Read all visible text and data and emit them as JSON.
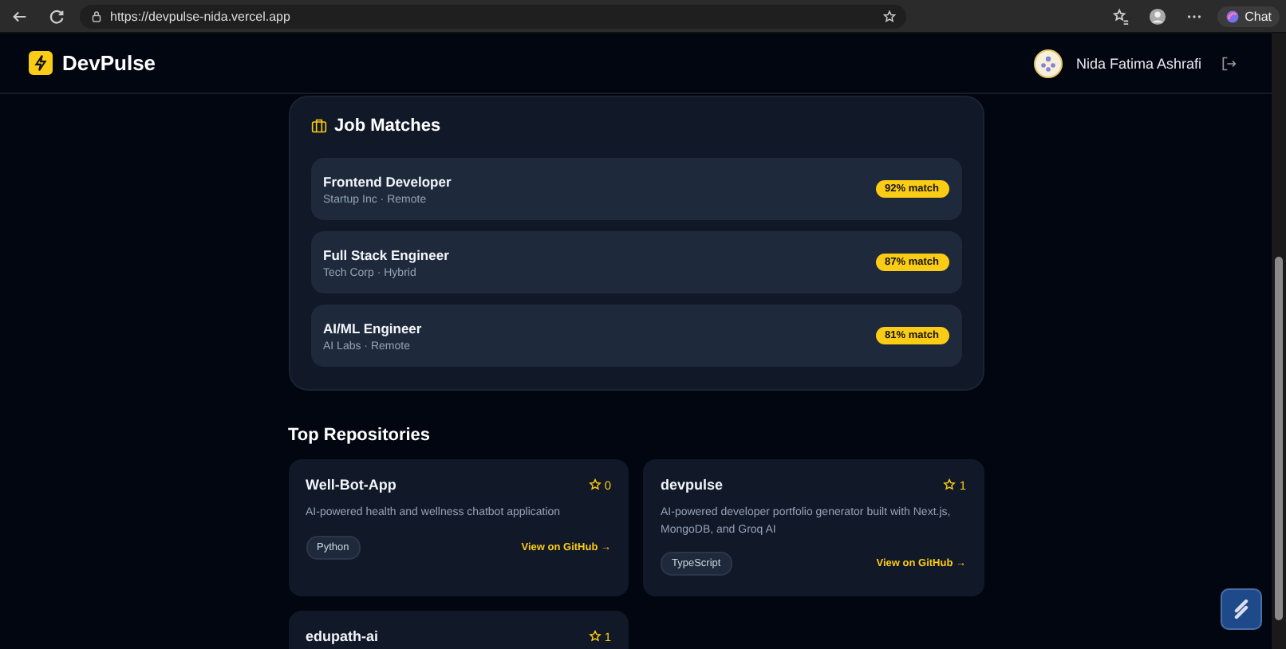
{
  "browser": {
    "url": "https://devpulse-nida.vercel.app",
    "chat_label": "Chat"
  },
  "header": {
    "brand": "DevPulse",
    "user_name": "Nida Fatima Ashrafi"
  },
  "job_matches": {
    "title": "Job Matches",
    "jobs": [
      {
        "title": "Frontend Developer",
        "meta": "Startup Inc · Remote",
        "match": "92% match"
      },
      {
        "title": "Full Stack Engineer",
        "meta": "Tech Corp · Hybrid",
        "match": "87% match"
      },
      {
        "title": "AI/ML Engineer",
        "meta": "AI Labs · Remote",
        "match": "81% match"
      }
    ]
  },
  "repositories": {
    "title": "Top Repositories",
    "repos": [
      {
        "name": "Well-Bot-App",
        "stars": "0",
        "description": "AI-powered health and wellness chatbot application",
        "language": "Python",
        "link": "View on GitHub →"
      },
      {
        "name": "devpulse",
        "stars": "1",
        "description": "AI-powered developer portfolio generator built with Next.js, MongoDB, and Groq AI",
        "language": "TypeScript",
        "link": "View on GitHub →"
      },
      {
        "name": "edupath-ai",
        "stars": "1"
      }
    ]
  }
}
